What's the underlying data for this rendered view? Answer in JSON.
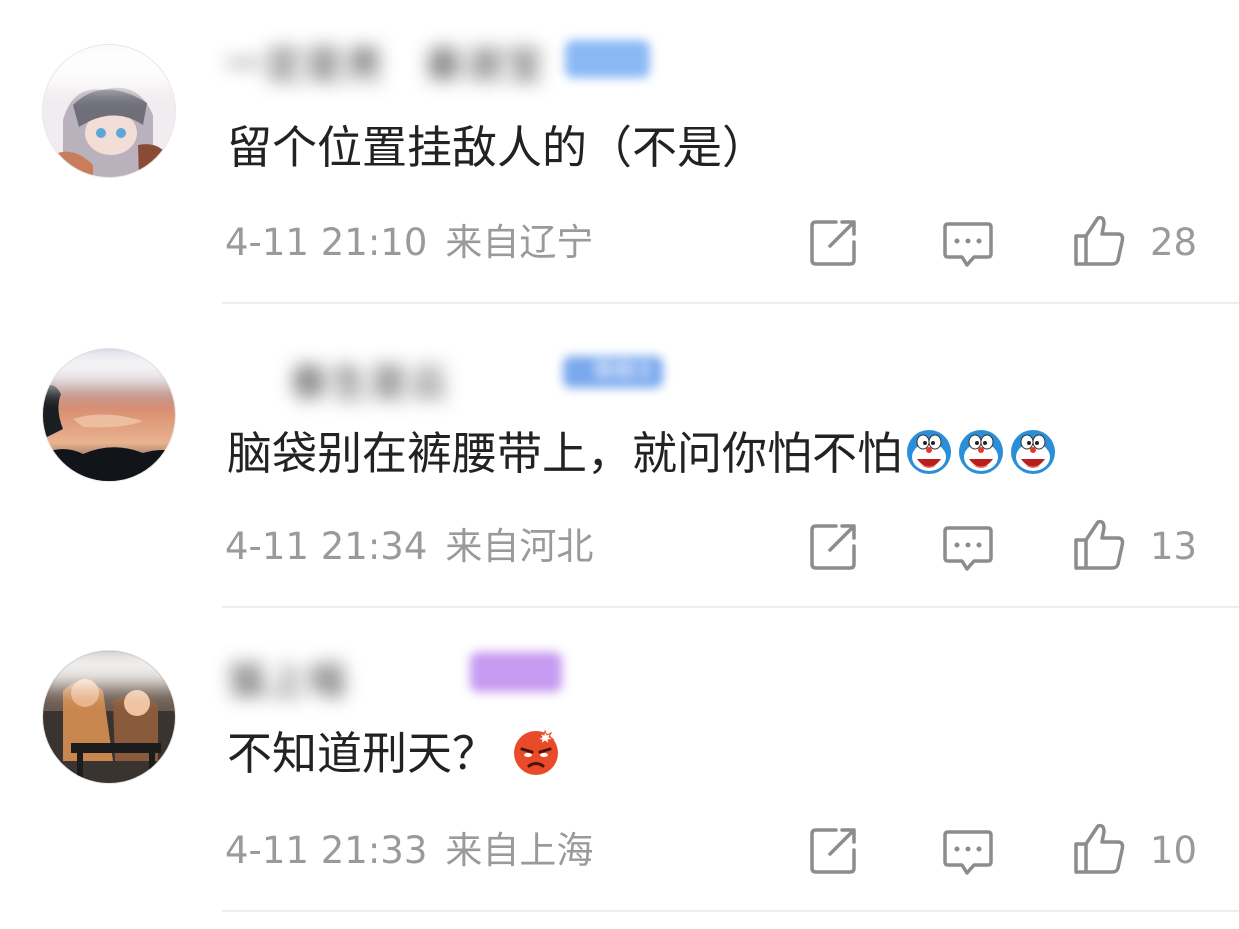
{
  "comments": [
    {
      "username": "一定是男　秦淑宝",
      "text": "留个位置挂敌人的（不是）",
      "time": "4-11 21:10",
      "location": "来自辽宁",
      "likes": "28",
      "badge_color": "#8ab8f5"
    },
    {
      "username": "春生是云",
      "badge_text": "铁粉3",
      "text": "脑袋别在裤腰带上，就问你怕不怕",
      "emojis": [
        "doraemon-laugh-emoji",
        "doraemon-laugh-emoji",
        "doraemon-laugh-emoji"
      ],
      "time": "4-11 21:34",
      "location": "来自河北",
      "likes": "13",
      "badge_color": "#7aa8ee"
    },
    {
      "username": "猫上喵",
      "text": "不知道刑天？",
      "emojis": [
        "angry-face-emoji"
      ],
      "time": "4-11 21:33",
      "location": "来自上海",
      "likes": "10",
      "badge_color": "#c69af0"
    }
  ],
  "icons": {
    "share": "share-icon",
    "comment": "comment-icon",
    "like": "thumbs-up-icon"
  },
  "colors": {
    "meta_text": "#9a9a9a",
    "icon_stroke": "#8c8c8c",
    "divider": "#ededed"
  }
}
